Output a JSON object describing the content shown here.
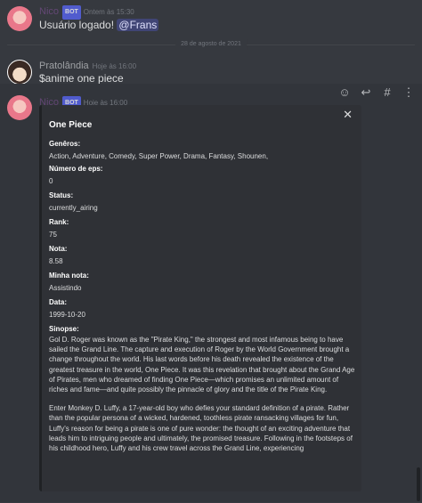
{
  "messages": [
    {
      "author": "Nico",
      "badge": "BOT",
      "timestamp": "Ontem às 15:30",
      "text": "Usuário logado! ",
      "mention": "@Frans"
    },
    {
      "author": "Pratolândia",
      "timestamp": "Hoje às 16:00",
      "text": "$anime one piece"
    },
    {
      "author": "Nico",
      "badge": "BOT",
      "timestamp": "Hoje às 16:00"
    }
  ],
  "date_divider": "28 de agosto de 2021",
  "embed": {
    "title": "One Piece",
    "fields": [
      {
        "name": "Genêros:",
        "value": "Action, Adventure, Comedy, Super Power, Drama, Fantasy, Shounen,"
      },
      {
        "name": "Número de eps:",
        "value": "0"
      },
      {
        "name": "Status:",
        "value": "currently_airing"
      },
      {
        "name": "Rank:",
        "value": "75"
      },
      {
        "name": "Nota:",
        "value": "8.58"
      },
      {
        "name": "Minha nota:",
        "value": "Assistindo"
      },
      {
        "name": "Data:",
        "value": "1999-10-20"
      }
    ],
    "synopsis_label": "Sinopse:",
    "synopsis_p1": "Gol D. Roger was known as the \"Pirate King,\" the strongest and most infamous being to have sailed the Grand Line. The capture and execution of Roger by the World Government brought a change throughout the world. His last words before his death revealed the existence of the greatest treasure in the world, One Piece. It was this revelation that brought about the Grand Age of Pirates, men who dreamed of finding One Piece—which promises an unlimited amount of riches and fame—and quite possibly the pinnacle of glory and the title of the Pirate King.",
    "synopsis_p2": "Enter Monkey D. Luffy, a 17-year-old boy who defies your standard definition of a pirate. Rather than the popular persona of a wicked, hardened, toothless pirate ransacking villages for fun, Luffy's reason for being a pirate is one of pure wonder: the thought of an exciting adventure that leads him to intriguing people and ultimately, the promised treasure. Following in the footsteps of his childhood hero, Luffy and his crew travel across the Grand Line, experiencing"
  },
  "toolbar": {
    "icons": [
      "add-reaction-icon",
      "reply-icon",
      "thread-icon",
      "more-icon"
    ]
  },
  "colors": {
    "background": "#36393f",
    "embed": "#2f3136",
    "bot_badge": "#5865f2",
    "mention": "#dee0fc"
  }
}
